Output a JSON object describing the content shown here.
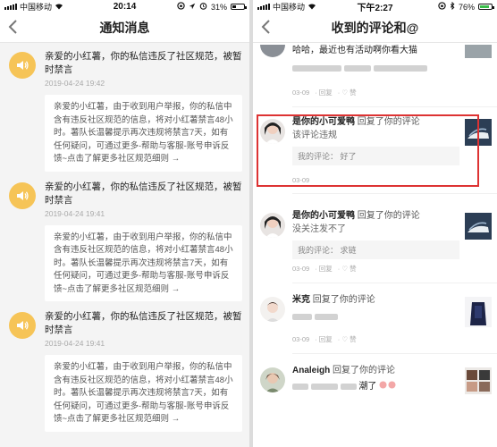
{
  "left": {
    "status": {
      "carrier": "中国移动",
      "time": "20:14",
      "battery": "31%"
    },
    "nav": {
      "title": "通知消息"
    },
    "notifications": [
      {
        "message": "亲爱的小红薯，你的私信违反了社区规范，被暂时禁言",
        "date": "2019-04-24 19:42",
        "detail": "亲爱的小红薯，由于收到用户举报，你的私信中含有违反社区规范的信息，将对小红薯禁言48小时。薯队长温馨提示再次违规将禁言7天，如有任何疑问，可通过更多-帮助与客服-账号申诉反馈~点击了解更多社区规范细则 →"
      },
      {
        "message": "亲爱的小红薯，你的私信违反了社区规范，被暂时禁言",
        "date": "2019-04-24 19:41",
        "detail": "亲爱的小红薯，由于收到用户举报，你的私信中含有违反社区规范的信息，将对小红薯禁言48小时。薯队长温馨提示再次违规将禁言7天，如有任何疑问，可通过更多-帮助与客服-账号申诉反馈~点击了解更多社区规范细则 →"
      },
      {
        "message": "亲爱的小红薯，你的私信违反了社区规范，被暂时禁言",
        "date": "2019-04-24 19:41",
        "detail": "亲爱的小红薯，由于收到用户举报，你的私信中含有违反社区规范的信息，将对小红薯禁言48小时。薯队长温馨提示再次违规将禁言7天，如有任何疑问，可通过更多-帮助与客服-账号申诉反馈~点击了解更多社区规范细则 →"
      }
    ]
  },
  "right": {
    "status": {
      "carrier": "中国移动",
      "time": "下午2:27",
      "battery": "76%"
    },
    "nav": {
      "title": "收到的评论和@"
    },
    "top_comment": {
      "text": "哈哈，最近也有活动啊你看大猫",
      "date": "03-09",
      "reply": "回复",
      "like": "赞"
    },
    "comments": [
      {
        "name": "是你的小可爱鸭",
        "action": "回复了你的评论",
        "sub": "该评论违规",
        "quote_label": "我的评论：",
        "quote_text": "好了",
        "date": "03-09"
      },
      {
        "name": "是你的小可爱鸭",
        "action": "回复了你的评论",
        "sub": "没关注发不了",
        "quote_label": "我的评论：",
        "quote_text": "求链",
        "date": "03-09",
        "reply": "回复",
        "like": "赞"
      },
      {
        "name": "米克",
        "action": "回复了你的评论",
        "date": "03-09",
        "reply": "回复",
        "like": "赞"
      },
      {
        "name": "Analeigh",
        "action": "回复了你的评论",
        "sub_tail": "潮了"
      }
    ],
    "colors": {
      "highlight": "#dd3333",
      "avatar_bg": "#f6c457"
    }
  }
}
